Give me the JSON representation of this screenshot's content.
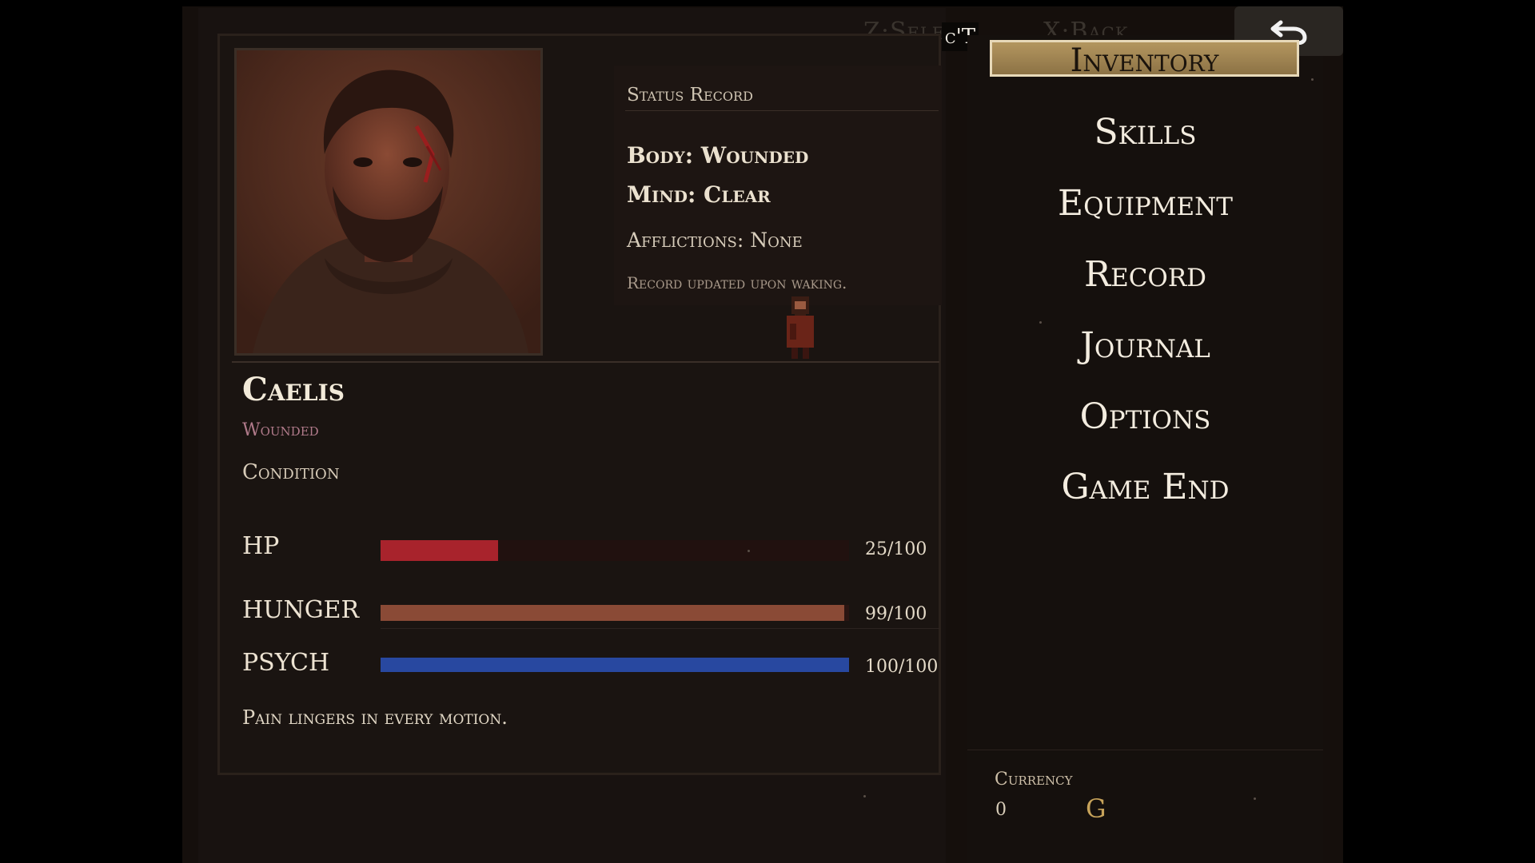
{
  "controls": {
    "select_hint": "Z:Select",
    "select_glyph": "c'T",
    "back_hint": "X:Back"
  },
  "status_record": {
    "title": "Status Record",
    "body": "Body: Wounded",
    "mind": "Mind: Clear",
    "afflictions": "Afflictions: None",
    "updated": "Record updated upon waking."
  },
  "character": {
    "name": "Caelis",
    "state": "Wounded",
    "condition_label": "Condition",
    "flavor": "Pain lingers in every motion."
  },
  "stats": [
    {
      "label": "HP",
      "value": "25/100",
      "fraction": 0.25,
      "color": "#a8232c"
    },
    {
      "label": "HUNGER",
      "value": "99/100",
      "fraction": 0.99,
      "color": "#8a4a36"
    },
    {
      "label": "PSYCH",
      "value": "100/100",
      "fraction": 1.0,
      "color": "#2848a0"
    }
  ],
  "menu": {
    "items": [
      "Inventory",
      "Skills",
      "Equipment",
      "Record",
      "Journal",
      "Options",
      "Game End"
    ],
    "active": "Inventory"
  },
  "currency": {
    "label": "Currency",
    "amount": "0",
    "unit": "G"
  },
  "icons": {
    "back": "back-arrow-icon"
  }
}
